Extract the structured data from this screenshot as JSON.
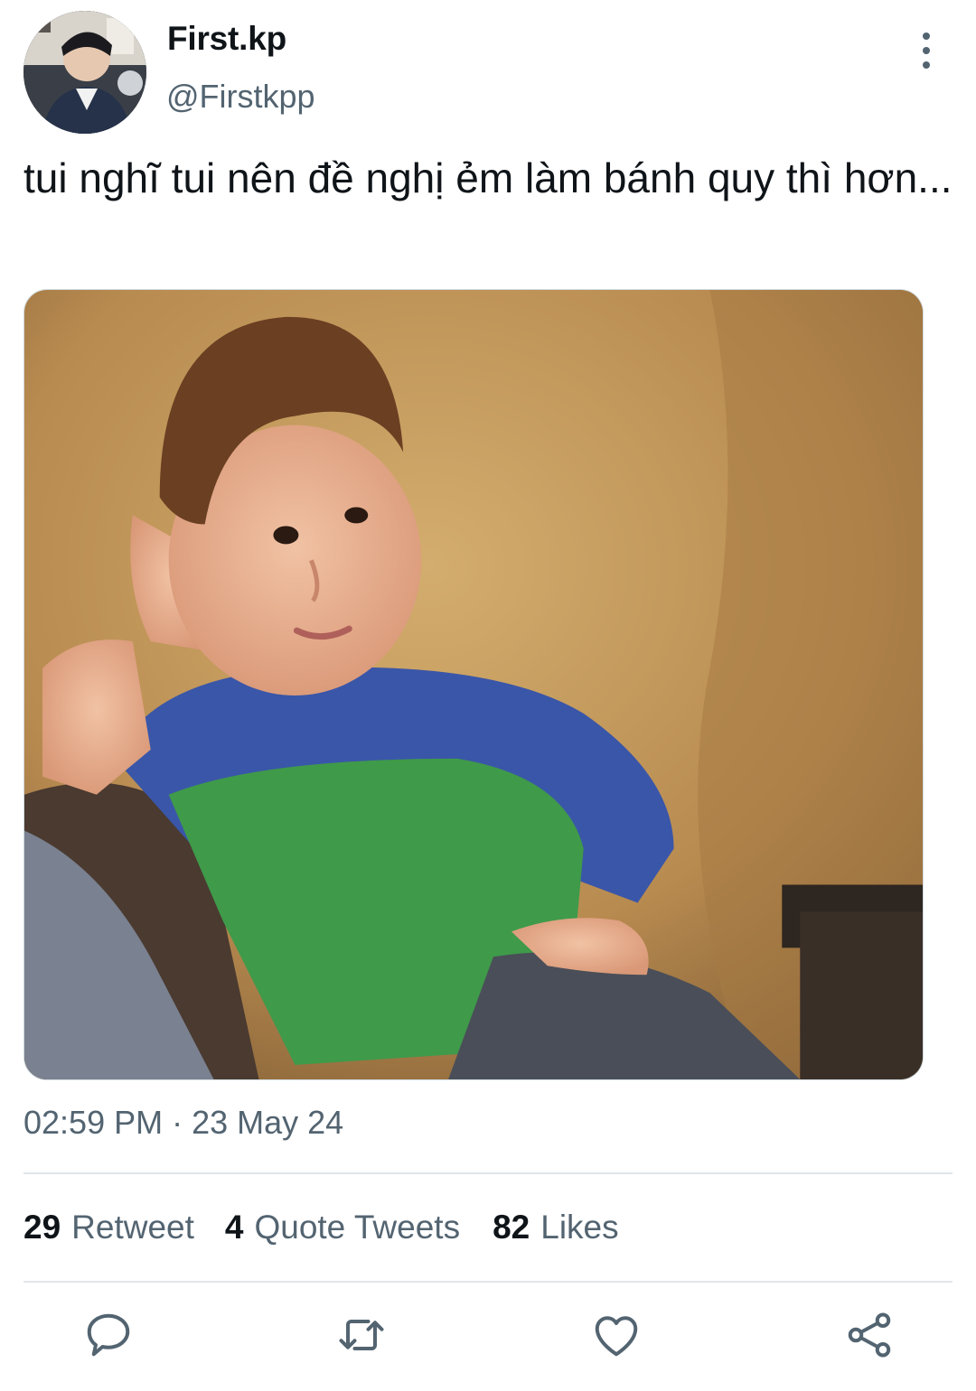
{
  "author": {
    "display_name": "First.kp",
    "handle": "@Firstkpp"
  },
  "tweet": {
    "text": "tui nghĩ tui nên đề nghị ẻm làm bánh quy thì hơn...",
    "timestamp": "02:59 PM · 23 May 24"
  },
  "stats": {
    "retweets": {
      "count": "29",
      "label": "Retweet"
    },
    "quotes": {
      "count": "4",
      "label": "Quote Tweets"
    },
    "likes": {
      "count": "82",
      "label": "Likes"
    }
  },
  "actions": {
    "reply_icon": "reply-icon",
    "retweet_icon": "retweet-icon",
    "like_icon": "heart-icon",
    "share_icon": "share-icon"
  },
  "colors": {
    "text_primary": "#0f1419",
    "text_secondary": "#536471",
    "divider": "#e1e6ea"
  }
}
